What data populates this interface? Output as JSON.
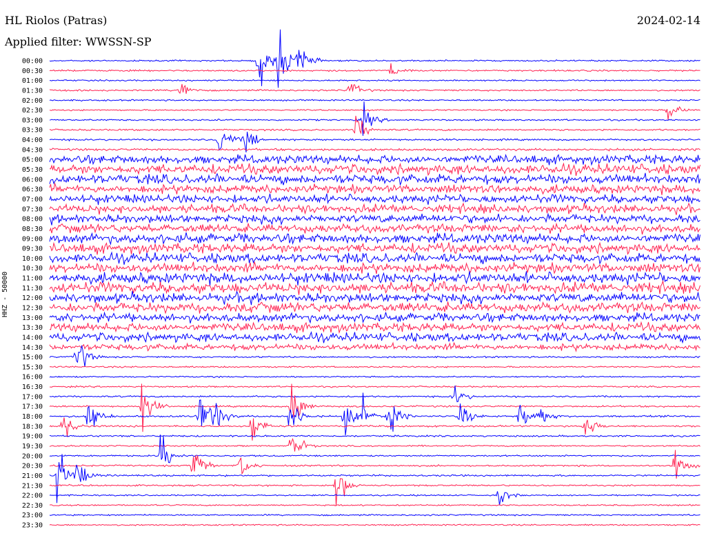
{
  "header": {
    "title": "HL Riolos (Patras)",
    "date": "2024-02-14",
    "filter": "Applied filter: WWSSN-SP"
  },
  "chart_data": {
    "type": "line",
    "title": "HL Riolos (Patras)",
    "date": "2024-02-14",
    "filter": "WWSSN-SP",
    "ylabel": "HHZ - 50000",
    "colors": [
      "#0000ff",
      "#ff1f4f"
    ],
    "rows": [
      {
        "label": "00:00",
        "amp": 1.5
      },
      {
        "label": "00:30",
        "amp": 1.6
      },
      {
        "label": "01:00",
        "amp": 1.4
      },
      {
        "label": "01:30",
        "amp": 1.6
      },
      {
        "label": "02:00",
        "amp": 1.5
      },
      {
        "label": "02:30",
        "amp": 1.4
      },
      {
        "label": "03:00",
        "amp": 1.6
      },
      {
        "label": "03:30",
        "amp": 1.7
      },
      {
        "label": "04:00",
        "amp": 1.8
      },
      {
        "label": "04:30",
        "amp": 2.2
      },
      {
        "label": "05:00",
        "amp": 8
      },
      {
        "label": "05:30",
        "amp": 9
      },
      {
        "label": "06:00",
        "amp": 9
      },
      {
        "label": "06:30",
        "amp": 8
      },
      {
        "label": "07:00",
        "amp": 8
      },
      {
        "label": "07:30",
        "amp": 8
      },
      {
        "label": "08:00",
        "amp": 8
      },
      {
        "label": "08:30",
        "amp": 8
      },
      {
        "label": "09:00",
        "amp": 9
      },
      {
        "label": "09:30",
        "amp": 9
      },
      {
        "label": "10:00",
        "amp": 9
      },
      {
        "label": "10:30",
        "amp": 9
      },
      {
        "label": "11:00",
        "amp": 10
      },
      {
        "label": "11:30",
        "amp": 10
      },
      {
        "label": "12:00",
        "amp": 9
      },
      {
        "label": "12:30",
        "amp": 9
      },
      {
        "label": "13:00",
        "amp": 8
      },
      {
        "label": "13:30",
        "amp": 8
      },
      {
        "label": "14:00",
        "amp": 8
      },
      {
        "label": "14:30",
        "amp": 6
      },
      {
        "label": "15:00",
        "amp": 1.6
      },
      {
        "label": "15:30",
        "amp": 1.5
      },
      {
        "label": "16:00",
        "amp": 1.4
      },
      {
        "label": "16:30",
        "amp": 1.5
      },
      {
        "label": "17:00",
        "amp": 1.6
      },
      {
        "label": "17:30",
        "amp": 1.7
      },
      {
        "label": "18:00",
        "amp": 1.8
      },
      {
        "label": "18:30",
        "amp": 1.8
      },
      {
        "label": "19:00",
        "amp": 1.6
      },
      {
        "label": "19:30",
        "amp": 1.5
      },
      {
        "label": "20:00",
        "amp": 1.5
      },
      {
        "label": "20:30",
        "amp": 1.6
      },
      {
        "label": "21:00",
        "amp": 1.7
      },
      {
        "label": "21:30",
        "amp": 1.6
      },
      {
        "label": "22:00",
        "amp": 1.4
      },
      {
        "label": "22:30",
        "amp": 1.4
      },
      {
        "label": "23:00",
        "amp": 1.5
      },
      {
        "label": "23:30",
        "amp": 1.4
      }
    ],
    "events": [
      {
        "row": 0,
        "t": 0.32,
        "amp": 14
      },
      {
        "row": 0,
        "t": 0.35,
        "amp": 12
      },
      {
        "row": 0,
        "t": 0.38,
        "amp": 9
      },
      {
        "row": 1,
        "t": 0.52,
        "amp": 4
      },
      {
        "row": 3,
        "t": 0.2,
        "amp": 5
      },
      {
        "row": 3,
        "t": 0.46,
        "amp": 4
      },
      {
        "row": 5,
        "t": 0.95,
        "amp": 4
      },
      {
        "row": 6,
        "t": 0.48,
        "amp": 6
      },
      {
        "row": 7,
        "t": 0.47,
        "amp": 6
      },
      {
        "row": 8,
        "t": 0.26,
        "amp": 7
      },
      {
        "row": 8,
        "t": 0.3,
        "amp": 6
      },
      {
        "row": 30,
        "t": 0.04,
        "amp": 10
      },
      {
        "row": 34,
        "t": 0.62,
        "amp": 5
      },
      {
        "row": 35,
        "t": 0.14,
        "amp": 12
      },
      {
        "row": 35,
        "t": 0.37,
        "amp": 12
      },
      {
        "row": 36,
        "t": 0.06,
        "amp": 8
      },
      {
        "row": 36,
        "t": 0.23,
        "amp": 10
      },
      {
        "row": 36,
        "t": 0.25,
        "amp": 9
      },
      {
        "row": 36,
        "t": 0.37,
        "amp": 8
      },
      {
        "row": 36,
        "t": 0.45,
        "amp": 8
      },
      {
        "row": 36,
        "t": 0.48,
        "amp": 6
      },
      {
        "row": 36,
        "t": 0.52,
        "amp": 8
      },
      {
        "row": 36,
        "t": 0.63,
        "amp": 6
      },
      {
        "row": 36,
        "t": 0.72,
        "amp": 7
      },
      {
        "row": 36,
        "t": 0.75,
        "amp": 5
      },
      {
        "row": 37,
        "t": 0.02,
        "amp": 6
      },
      {
        "row": 37,
        "t": 0.31,
        "amp": 7
      },
      {
        "row": 37,
        "t": 0.82,
        "amp": 6
      },
      {
        "row": 39,
        "t": 0.37,
        "amp": 8
      },
      {
        "row": 40,
        "t": 0.17,
        "amp": 9
      },
      {
        "row": 41,
        "t": 0.22,
        "amp": 8
      },
      {
        "row": 41,
        "t": 0.29,
        "amp": 6
      },
      {
        "row": 41,
        "t": 0.96,
        "amp": 8
      },
      {
        "row": 42,
        "t": 0.01,
        "amp": 12
      },
      {
        "row": 42,
        "t": 0.04,
        "amp": 7
      },
      {
        "row": 43,
        "t": 0.44,
        "amp": 10
      },
      {
        "row": 44,
        "t": 0.69,
        "amp": 4
      }
    ]
  }
}
